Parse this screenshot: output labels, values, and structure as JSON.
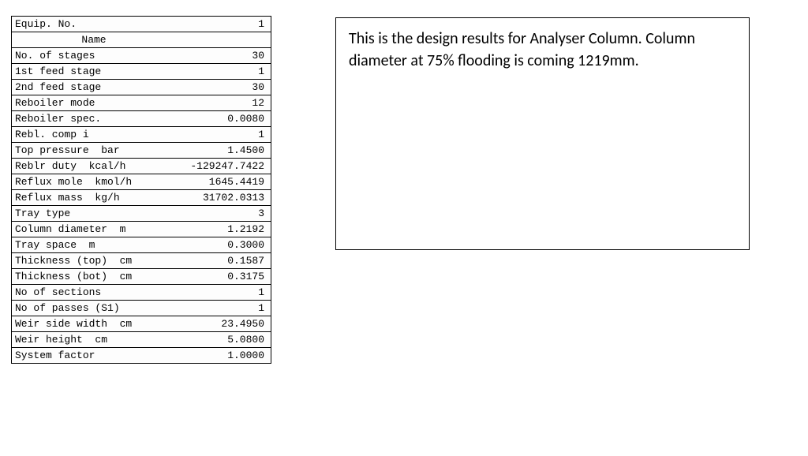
{
  "table": {
    "header": {
      "equip_no_label": "Equip. No.",
      "equip_no_value": "1",
      "name_label": "Name"
    },
    "rows": [
      {
        "label": "No. of stages",
        "value": "30"
      },
      {
        "label": "1st feed stage",
        "value": "1"
      },
      {
        "label": "2nd feed stage",
        "value": "30"
      },
      {
        "label": "Reboiler mode",
        "value": "12"
      },
      {
        "label": "Reboiler spec.",
        "value": "0.0080"
      },
      {
        "label": "Rebl. comp i",
        "value": "1"
      },
      {
        "label": "Top pressure  bar",
        "value": "1.4500"
      },
      {
        "label": "Reblr duty  kcal/h",
        "value": "-129247.7422"
      },
      {
        "label": "Reflux mole  kmol/h",
        "value": "1645.4419"
      },
      {
        "label": "Reflux mass  kg/h",
        "value": "31702.0313"
      },
      {
        "label": "Tray type",
        "value": "3"
      },
      {
        "label": "Column diameter  m",
        "value": "1.2192"
      },
      {
        "label": "Tray space  m",
        "value": "0.3000"
      },
      {
        "label": "Thickness (top)  cm",
        "value": "0.1587"
      },
      {
        "label": "Thickness (bot)  cm",
        "value": "0.3175"
      },
      {
        "label": "No of sections",
        "value": "1"
      },
      {
        "label": "No of passes (S1)",
        "value": "1"
      },
      {
        "label": "Weir side width  cm",
        "value": "23.4950"
      },
      {
        "label": "Weir height  cm",
        "value": "5.0800"
      },
      {
        "label": "System factor",
        "value": "1.0000"
      }
    ]
  },
  "description": {
    "text": "This is the design results for Analyser Column. Column diameter at 75% flooding is coming 1219mm."
  }
}
